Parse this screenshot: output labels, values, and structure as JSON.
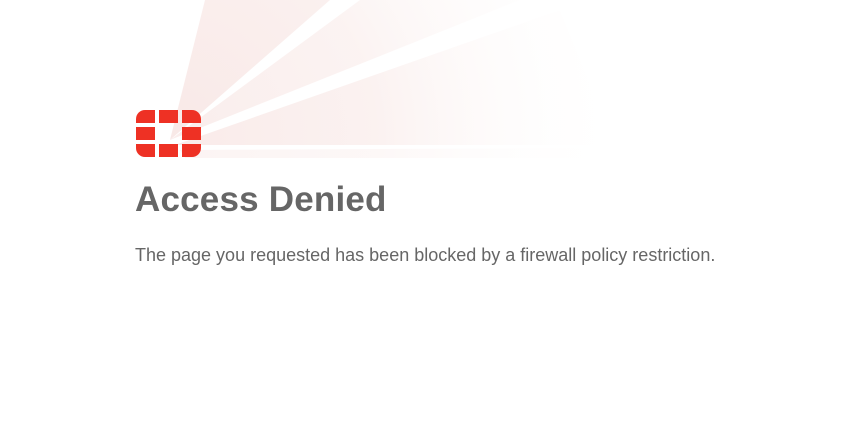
{
  "page": {
    "title": "Access Denied",
    "message": "The page you requested has been blocked by a firewall policy restriction."
  },
  "logo": {
    "icon": "firewall-logo-icon",
    "color": "#ee3124"
  },
  "colors": {
    "text": "#666666",
    "background": "#ffffff",
    "rays": "#f3d6d3"
  }
}
